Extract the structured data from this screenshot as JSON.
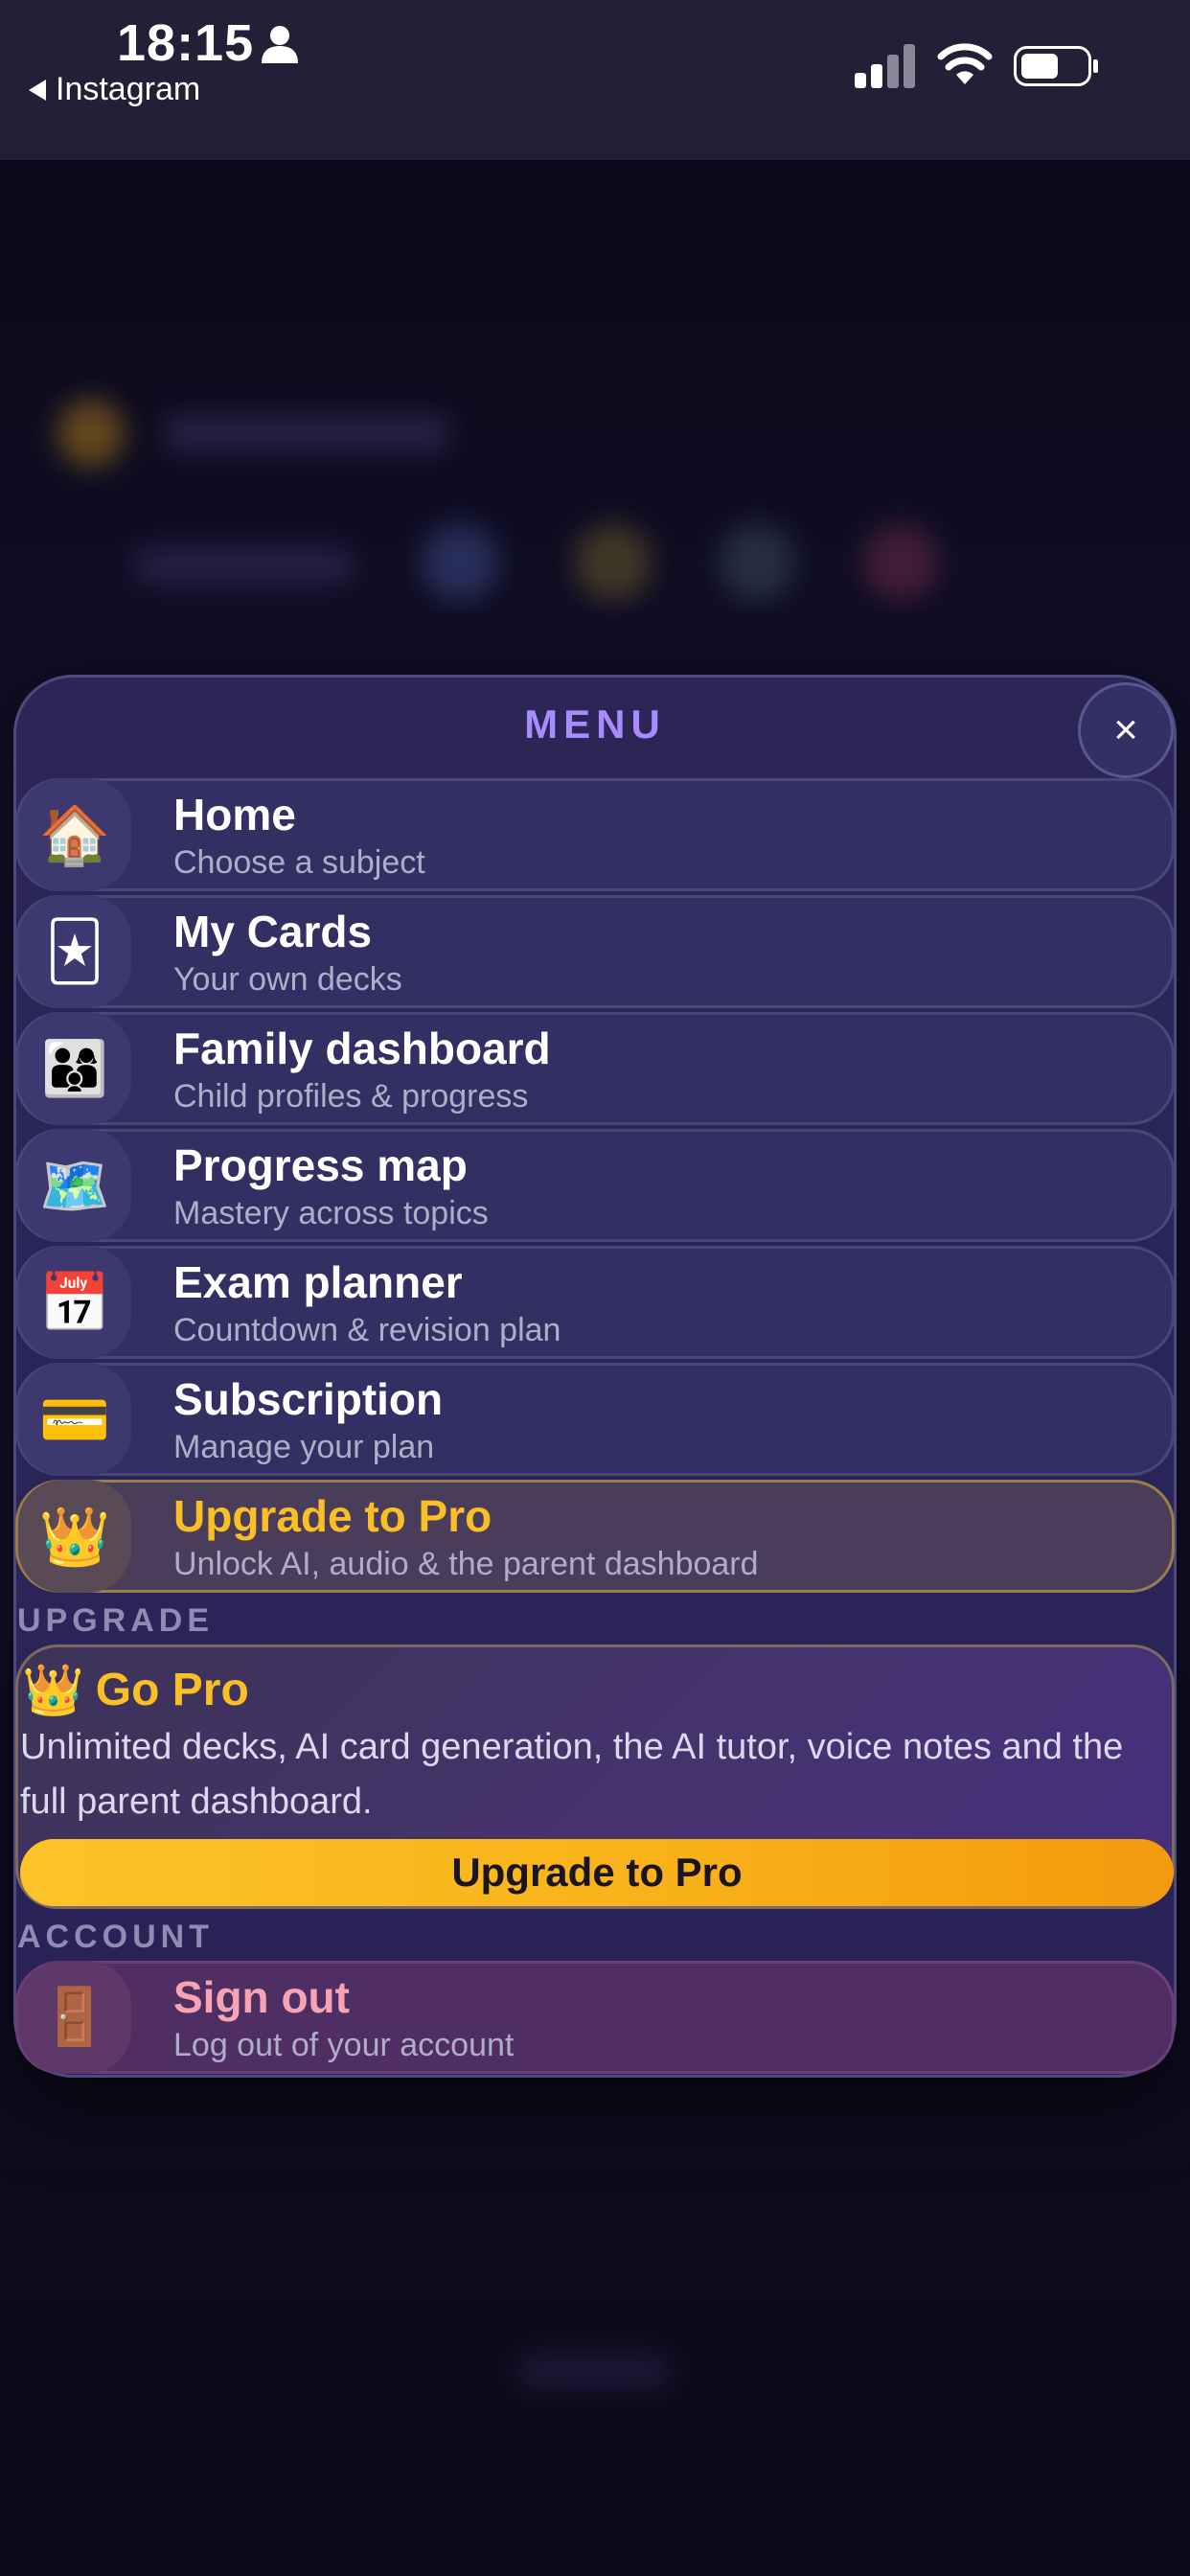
{
  "status_bar": {
    "time": "18:15",
    "back_app": "Instagram"
  },
  "menu": {
    "title": "MENU",
    "close_glyph": "×",
    "items": [
      {
        "label": "Home",
        "subtitle": "Choose a subject",
        "icon": "house-icon",
        "emoji": "🏠"
      },
      {
        "label": "My Cards",
        "subtitle": "Your own decks",
        "icon": "joker-card-icon",
        "emoji": "🃏"
      },
      {
        "label": "Family dashboard",
        "subtitle": "Child profiles & progress",
        "icon": "family-icon",
        "emoji": "👨‍👩‍👦"
      },
      {
        "label": "Progress map",
        "subtitle": "Mastery across topics",
        "icon": "world-map-icon",
        "emoji": "🗺️"
      },
      {
        "label": "Exam planner",
        "subtitle": "Countdown & revision plan",
        "icon": "calendar-icon",
        "emoji": "📅"
      },
      {
        "label": "Subscription",
        "subtitle": "Manage your plan",
        "icon": "credit-card-icon",
        "emoji": "💳"
      },
      {
        "label": "Upgrade to Pro",
        "subtitle": "Unlock AI, audio & the parent dashboard",
        "icon": "crown-icon",
        "emoji": "👑"
      }
    ],
    "upgrade_section": {
      "heading": "UPGRADE",
      "card_title": "Go Pro",
      "card_emoji": "👑",
      "description": "Unlimited decks, AI card generation, the AI tutor, voice notes and the full parent dashboard.",
      "button_label": "Upgrade to Pro"
    },
    "account_section": {
      "heading": "ACCOUNT",
      "signout_label": "Sign out",
      "signout_subtitle": "Log out of your account",
      "signout_emoji": "🚪"
    }
  },
  "colors": {
    "accent_purple": "#a88cff",
    "pro_gold": "#fbbf26",
    "signout_pink": "#f7a3b4"
  }
}
